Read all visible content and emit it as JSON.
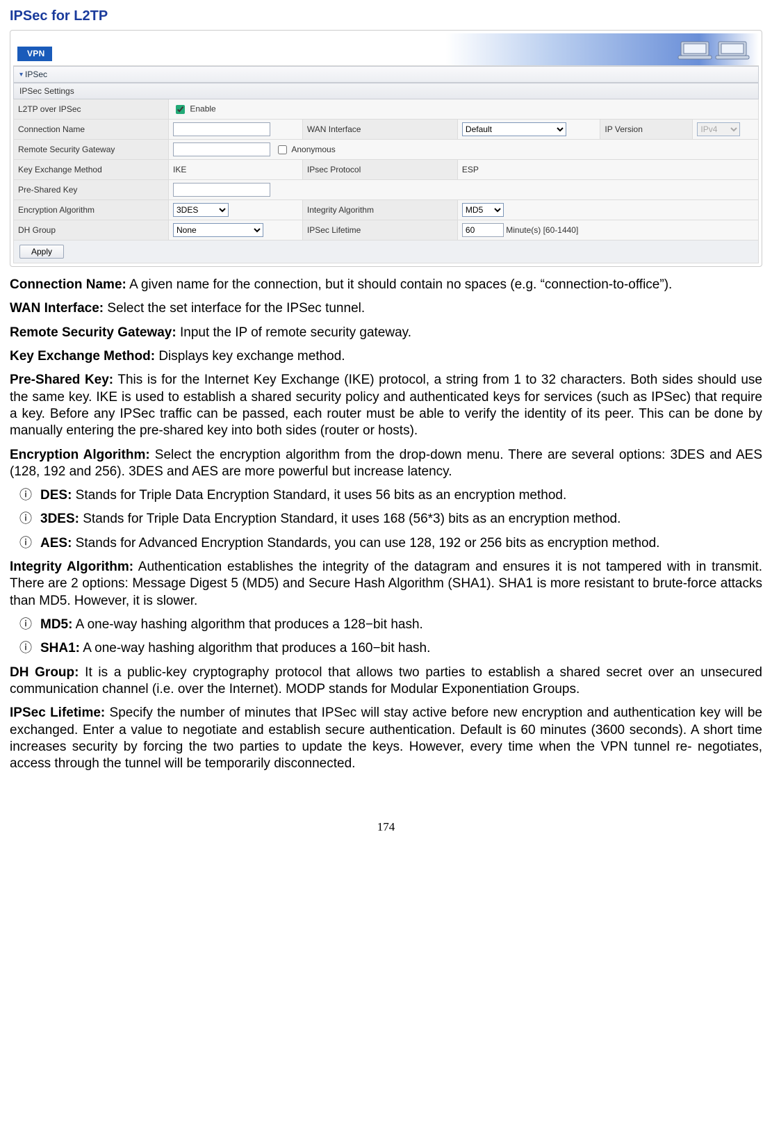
{
  "page": {
    "heading": "IPSec for L2TP",
    "number": "174"
  },
  "panel": {
    "banner_tag": "VPN",
    "section": "IPSec",
    "settings_header": "IPSec Settings",
    "rows": {
      "l2tp_label": "L2TP over IPSec",
      "enable_label": "Enable",
      "conn_label": "Connection Name",
      "wan_label": "WAN Interface",
      "wan_value": "Default",
      "ipver_label": "IP Version",
      "ipver_value": "IPv4",
      "rsg_label": "Remote Security Gateway",
      "anon_label": "Anonymous",
      "kex_label": "Key Exchange Method",
      "kex_value": "IKE",
      "ipsecproto_label": "IPsec Protocol",
      "ipsecproto_value": "ESP",
      "psk_label": "Pre-Shared Key",
      "enc_label": "Encryption Algorithm",
      "enc_value": "3DES",
      "integ_label": "Integrity Algorithm",
      "integ_value": "MD5",
      "dh_label": "DH Group",
      "dh_value": "None",
      "life_label": "IPSec Lifetime",
      "life_value": "60",
      "life_unit": "Minute(s) [60-1440]"
    },
    "apply": "Apply"
  },
  "copy": {
    "conn_lead": "Connection Name:",
    "conn_text": " A given name for the connection, but it should contain no spaces (e.g. “connection-to-office”).",
    "wan_lead": "WAN Interface:",
    "wan_text": " Select the set interface for the IPSec tunnel.",
    "rsg_lead": "Remote Security Gateway:",
    "rsg_text": " Input the IP of remote security gateway.",
    "kex_lead": "Key Exchange Method:",
    "kex_text": " Displays key exchange method.",
    "psk_lead": "Pre-Shared Key:",
    "psk_text": " This is for the Internet Key Exchange (IKE) protocol, a string from 1 to 32 characters. Both sides should use the same key. IKE is used to establish a shared security policy and authenticated keys for services (such as IPSec) that require a key. Before any IPSec traffic can be passed, each router must be able to verify the identity of its peer. This can be done by manually entering the pre-shared key into both sides (router or hosts).",
    "enc_lead": "Encryption Algorithm:",
    "enc_text": " Select the encryption algorithm from the drop-down menu. There are several options: 3DES and AES (128, 192 and 256). 3DES and AES are more powerful but increase latency.",
    "enc_b1_lead": "DES:",
    "enc_b1_text": " Stands for Triple Data Encryption Standard, it uses 56 bits as an encryption method.",
    "enc_b2_lead": "3DES:",
    "enc_b2_text": " Stands for Triple Data Encryption Standard, it uses 168 (56*3) bits as an encryption method.",
    "enc_b3_lead": "AES:",
    "enc_b3_text": " Stands for Advanced Encryption Standards, you can use 128, 192 or 256 bits as encryption method.",
    "int_lead": "Integrity Algorithm:",
    "int_text": " Authentication establishes the integrity of the datagram and ensures it is not tampered with in transmit. There are 2 options: Message Digest 5 (MD5) and Secure Hash Algorithm (SHA1). SHA1 is more resistant to brute-force attacks than MD5. However, it is slower.",
    "int_b1_lead": "MD5:",
    "int_b1_text": " A one-way hashing algorithm that produces a 128−bit hash.",
    "int_b2_lead": "SHA1:",
    "int_b2_text": " A one-way hashing algorithm that produces a 160−bit hash.",
    "dh_lead": "DH Group:",
    "dh_text": " It is a public-key cryptography protocol that allows two parties to establish a shared secret over an unsecured communication channel (i.e. over the Internet). MODP stands for Modular Exponentiation Groups.",
    "life_lead": "IPSec Lifetime:",
    "life_text": " Specify the number of minutes that IPSec will stay active before new encryption and authentication key will be exchanged. Enter a value to negotiate and establish secure authentication. Default is 60 minutes (3600 seconds). A short time increases security by forcing the two parties to update the keys. However, every time when the VPN tunnel re- negotiates, access through the tunnel will be temporarily disconnected."
  }
}
